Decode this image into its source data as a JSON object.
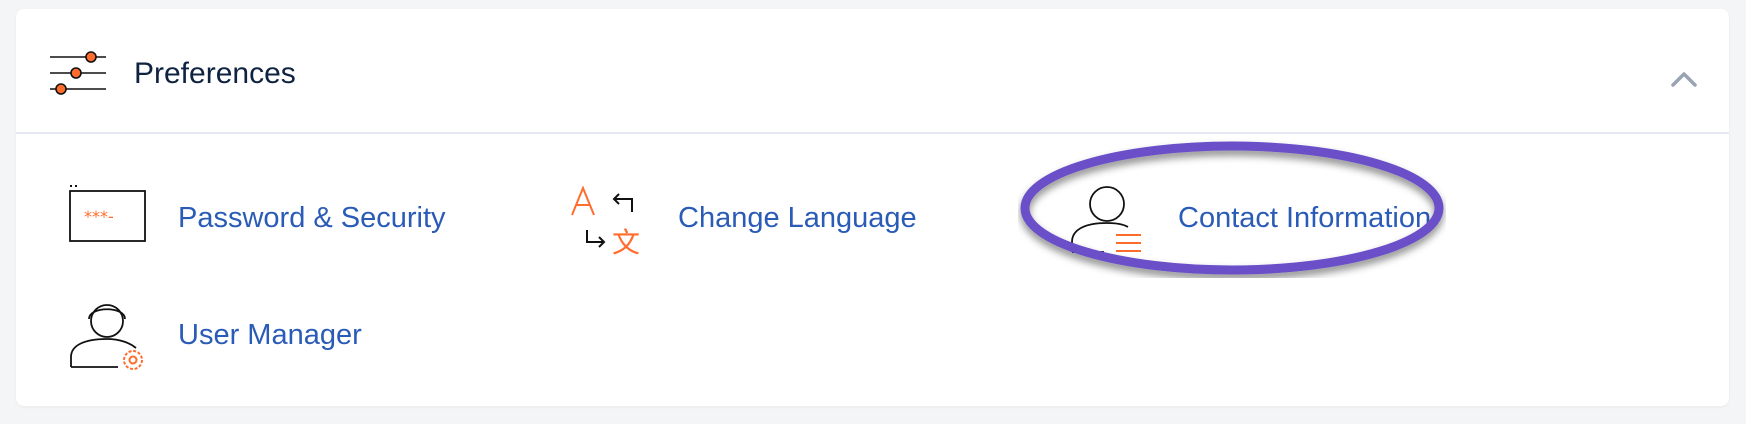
{
  "section": {
    "title": "Preferences",
    "header_icon": "sliders-icon",
    "collapse_icon": "chevron-up-icon"
  },
  "items": [
    {
      "label": "Password & Security",
      "icon": "password-field-icon"
    },
    {
      "label": "Change Language",
      "icon": "translate-icon"
    },
    {
      "label": "Contact Information",
      "icon": "contact-card-icon"
    },
    {
      "label": "User Manager",
      "icon": "user-gear-icon"
    }
  ],
  "colors": {
    "accent_orange": "#ff6c2c",
    "link_blue": "#2a5bb6",
    "title_navy": "#0f2341",
    "highlight_purple": "#6a4fc8"
  }
}
